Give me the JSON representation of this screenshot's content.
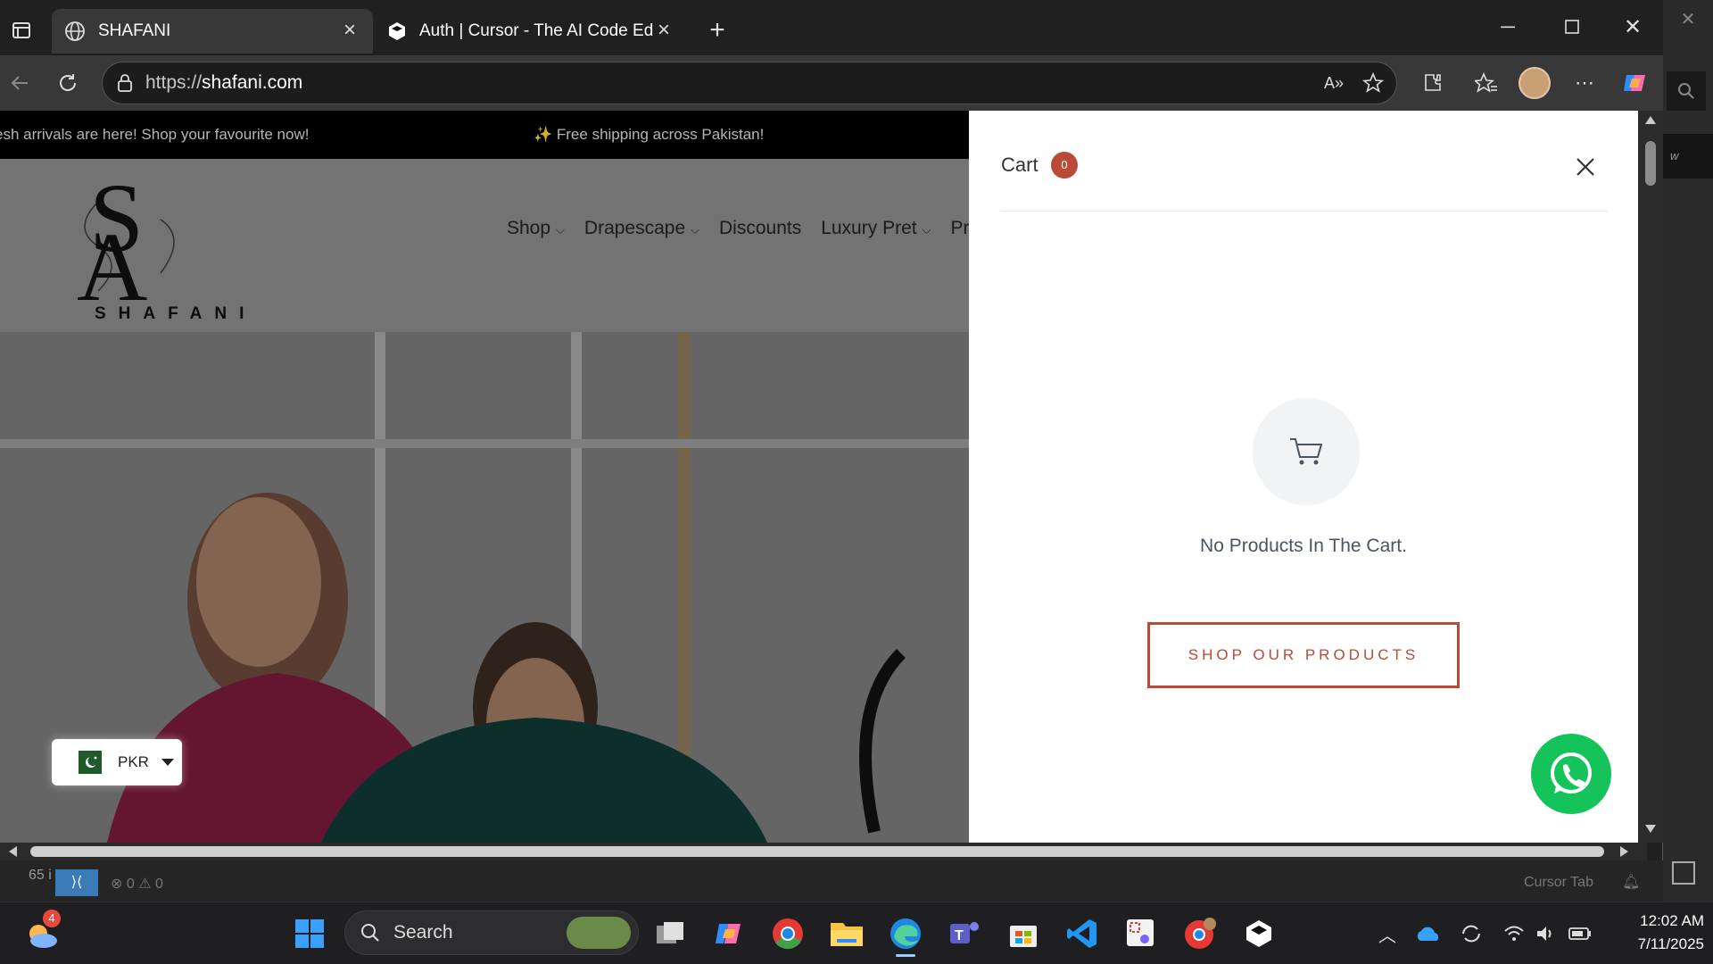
{
  "browser": {
    "tabs": [
      {
        "label": "SHAFANI",
        "icon": "globe-icon"
      },
      {
        "label": "Auth | Cursor - The AI Code Editor",
        "icon": "cursor-logo-icon"
      }
    ],
    "url_proto": "https://",
    "url_host": "shafani.com"
  },
  "site": {
    "announcement_left": "esh arrivals are here! Shop your favourite now!",
    "announcement_right": "✨ Free shipping across Pakistan!",
    "logo_text": "SHAFANI",
    "nav": [
      "Shop",
      "Drapescape",
      "Discounts",
      "Luxury Pret",
      "Pr"
    ],
    "currency": "PKR"
  },
  "cart": {
    "title": "Cart",
    "count": "0",
    "empty_message": "No Products In The Cart.",
    "shop_button": "SHOP OUR PRODUCTS"
  },
  "statusbar": {
    "left": "65 i",
    "problems": "⊗ 0 ⚠ 0",
    "right": "Cursor Tab"
  },
  "background_app": {
    "fragment": "w"
  },
  "taskbar": {
    "search_label": "Search",
    "weather_badge": "4",
    "time": "12:02 AM",
    "date": "7/11/2025"
  },
  "colors": {
    "accent": "#b84a36",
    "whatsapp": "#14c35a"
  }
}
